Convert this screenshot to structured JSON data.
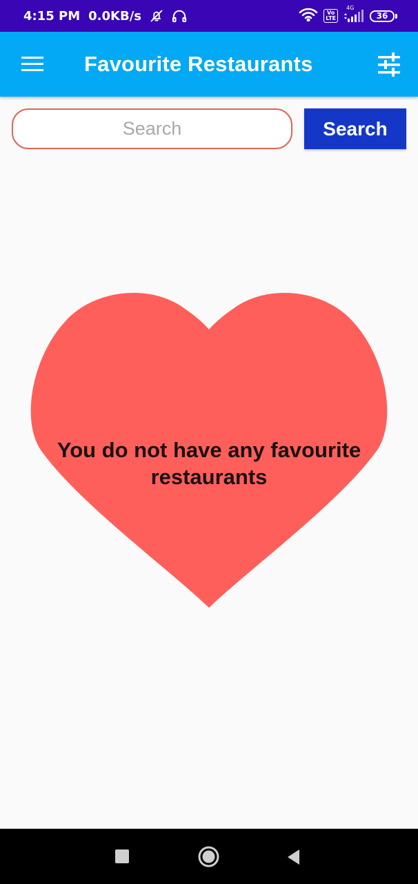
{
  "status_bar": {
    "time": "4:15 PM",
    "net_speed": "0.0KB/s",
    "mute_icon": "bell-off-icon",
    "headset_icon": "headphones-icon",
    "wifi_icon": "wifi-icon",
    "volte_top": "Vo",
    "volte_bottom": "LTE",
    "network_type": "4G",
    "signal_icon": "cell-signal-icon",
    "battery_level": "36"
  },
  "app_bar": {
    "menu_icon": "hamburger-menu-icon",
    "title": "Favourite Restaurants",
    "filter_icon": "tune-sliders-icon",
    "background_color": "#03a9f4"
  },
  "search": {
    "placeholder": "Search",
    "value": "",
    "button_label": "Search",
    "button_color": "#1537c8",
    "input_border_color": "#e0645a"
  },
  "empty_state": {
    "icon": "heart-icon",
    "icon_color": "#ff5f5a",
    "message": "You do not have any favourite restaurants"
  },
  "nav_bar": {
    "recents_icon": "square-recents-icon",
    "home_icon": "circle-home-icon",
    "back_icon": "triangle-back-icon"
  }
}
